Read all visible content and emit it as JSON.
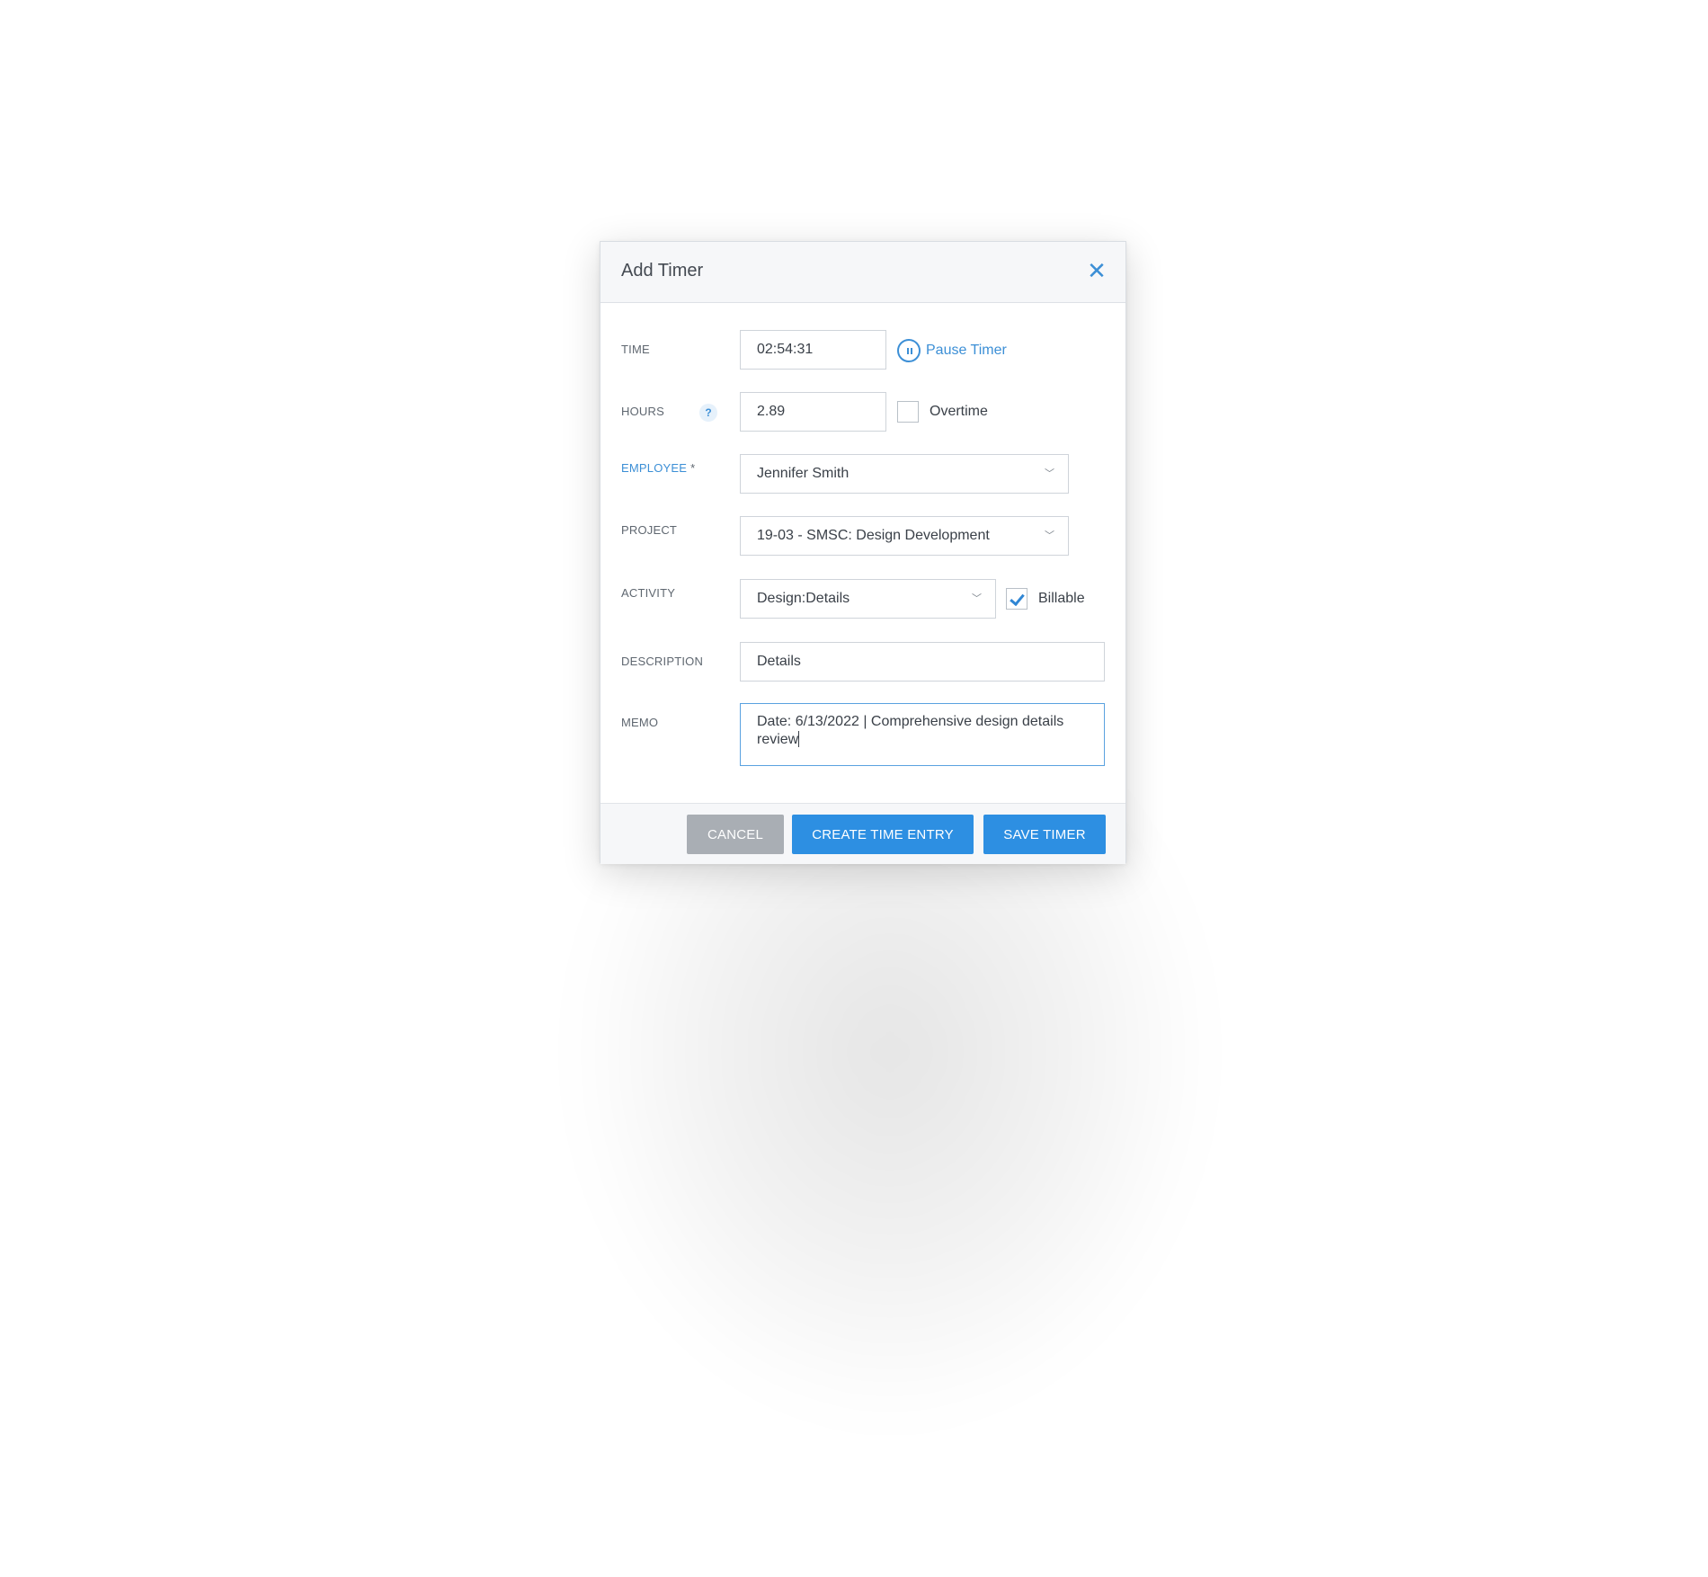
{
  "dialog": {
    "title": "Add Timer",
    "close_icon": "close-icon"
  },
  "fields": {
    "time": {
      "label": "TIME",
      "value": "02:54:31"
    },
    "pause_timer": {
      "label": "Pause Timer",
      "icon": "pause-icon"
    },
    "hours": {
      "label": "HOURS",
      "help_icon": "?",
      "value": "2.89"
    },
    "overtime": {
      "label": "Overtime",
      "checked": false
    },
    "employee": {
      "label": "EMPLOYEE",
      "required_mark": "*",
      "value": "Jennifer Smith"
    },
    "project": {
      "label": "PROJECT",
      "value": "19-03 - SMSC: Design Development"
    },
    "activity": {
      "label": "ACTIVITY",
      "value": "Design:Details"
    },
    "billable": {
      "label": "Billable",
      "checked": true
    },
    "description": {
      "label": "DESCRIPTION",
      "value": "Details"
    },
    "memo": {
      "label": "MEMO",
      "value": "Date: 6/13/2022 | Comprehensive design details review"
    }
  },
  "footer": {
    "cancel_label": "CANCEL",
    "create_label": "CREATE TIME ENTRY",
    "save_label": "SAVE TIMER"
  },
  "colors": {
    "accent": "#2d8fe2",
    "link": "#3c8fd6",
    "cancel": "#a9aeb4"
  }
}
